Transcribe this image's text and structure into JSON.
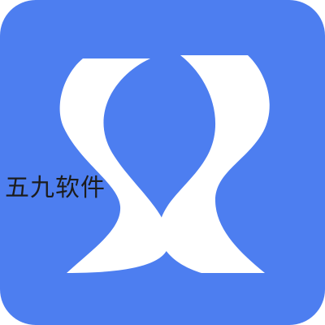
{
  "app_icon": {
    "background_color": "#4d7ef0",
    "glyph_color": "#ffffff",
    "glyph": "stylized-double-s-logo-icon"
  },
  "watermark": {
    "text": "五九软件",
    "color": "#1c1c1c"
  }
}
